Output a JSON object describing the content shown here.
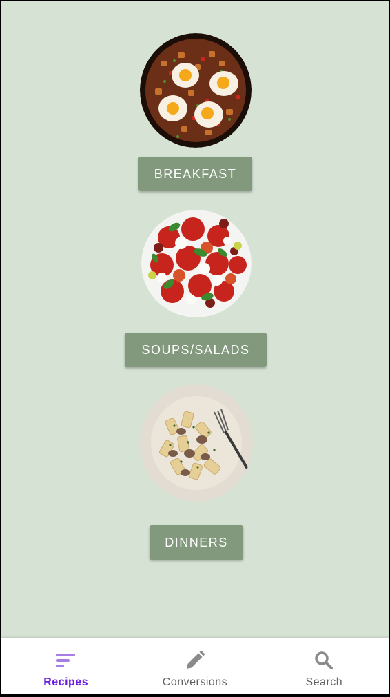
{
  "categories": [
    {
      "id": "breakfast",
      "label": "BREAKFAST",
      "image": "breakfast-skillet-image"
    },
    {
      "id": "soups-salads",
      "label": "SOUPS/SALADS",
      "image": "caprese-salad-image"
    },
    {
      "id": "dinners",
      "label": "DINNERS",
      "image": "pasta-dish-image"
    }
  ],
  "bottom_nav": {
    "items": [
      {
        "label": "Recipes",
        "icon": "sort-lines-icon",
        "active": true
      },
      {
        "label": "Conversions",
        "icon": "pencil-icon",
        "active": false
      },
      {
        "label": "Search",
        "icon": "search-icon",
        "active": false
      }
    ]
  },
  "colors": {
    "background": "#d5e2d4",
    "button": "#82997d",
    "button_text": "#ffffff",
    "nav_active": "#6a1be0",
    "nav_inactive": "#616161"
  }
}
